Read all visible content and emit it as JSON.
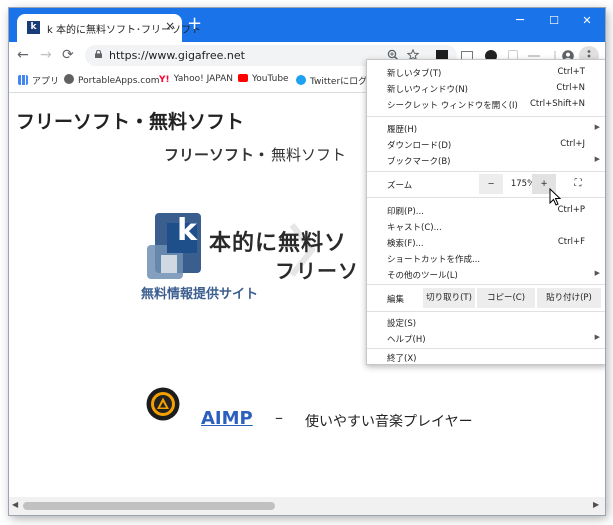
{
  "tab": {
    "title": "k 本的に無料ソフト･フリーソフト",
    "favicon": "k",
    "close": "×"
  },
  "newtab": "+",
  "window": {
    "minimize": "─",
    "maximize": "☐",
    "close": "✕"
  },
  "nav": {
    "back": "←",
    "forward": "→",
    "reload": "⟳"
  },
  "address": {
    "url": "https://www.gigafree.net"
  },
  "bookmarks": [
    {
      "label": "アプリ",
      "color": "#5f6368"
    },
    {
      "label": "PortableApps.com",
      "color": "#616161"
    },
    {
      "label": "Yahoo! JAPAN",
      "color": "#ff0033"
    },
    {
      "label": "YouTube",
      "color": "#ff0000"
    },
    {
      "label": "Twitterにログイン",
      "color": "#1da1f2"
    }
  ],
  "page": {
    "title": "フリーソフト・無料ソフト",
    "subtitle_bold": "フリーソフト・",
    "subtitle_normal": "無料ソフト",
    "subtitle_paren": "（",
    "logo_line1": "本的に無料ソ",
    "logo_line2": "フリーソ",
    "logo_line3": "無料情報提供サイト",
    "logo_k": "k",
    "aimp_link": "AIMP",
    "aimp_dash": "–",
    "aimp_desc": "使いやすい音楽プレイヤー"
  },
  "menu": {
    "new_tab": "新しいタブ(T)",
    "new_tab_sc": "Ctrl+T",
    "new_window": "新しいウィンドウ(N)",
    "new_window_sc": "Ctrl+N",
    "incognito": "シークレット ウィンドウを開く(I)",
    "incognito_sc": "Ctrl+Shift+N",
    "history": "履歴(H)",
    "downloads": "ダウンロード(D)",
    "downloads_sc": "Ctrl+J",
    "bookmarks": "ブックマーク(B)",
    "zoom": "ズーム",
    "zoom_minus": "−",
    "zoom_level": "175%",
    "zoom_plus": "+",
    "fullscreen": "⛶",
    "print": "印刷(P)...",
    "print_sc": "Ctrl+P",
    "cast": "キャスト(C)...",
    "find": "検索(F)...",
    "find_sc": "Ctrl+F",
    "shortcut": "ショートカットを作成...",
    "more_tools": "その他のツール(L)",
    "edit": "編集",
    "cut": "切り取り(T)",
    "copy": "コピー(C)",
    "paste": "貼り付け(P)",
    "settings": "設定(S)",
    "help": "ヘルプ(H)",
    "exit": "終了(X)",
    "arrow": "▶"
  }
}
